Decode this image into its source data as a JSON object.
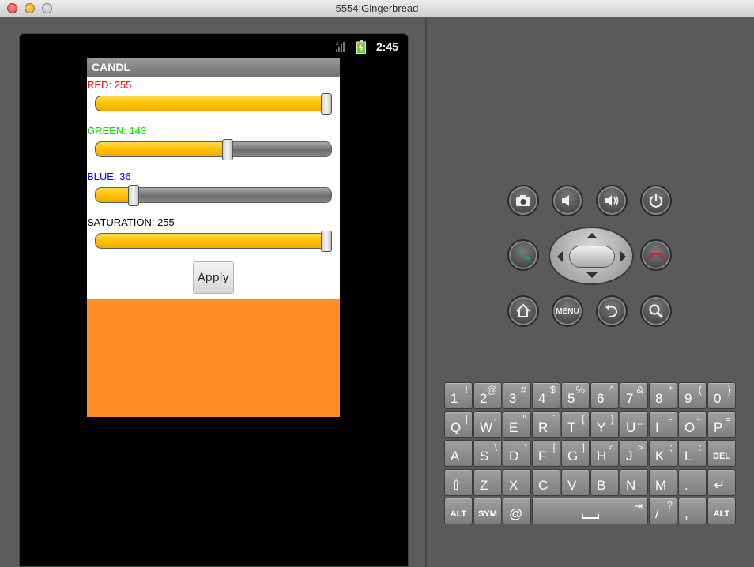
{
  "window": {
    "title": "5554:Gingerbread"
  },
  "status_bar": {
    "time": "2:45"
  },
  "app": {
    "title": "CANDL",
    "sliders": [
      {
        "label": "RED: 255",
        "value": 255,
        "max": 255,
        "color": "#ff0000"
      },
      {
        "label": "GREEN: 143",
        "value": 143,
        "max": 255,
        "color": "#00e000"
      },
      {
        "label": "BLUE: 36",
        "value": 36,
        "max": 255,
        "color": "#0000ff"
      },
      {
        "label": "SATURATION: 255",
        "value": 255,
        "max": 255,
        "color": "#000000"
      }
    ],
    "apply_label": "Apply",
    "preview_color": "#ff8f24"
  },
  "hardware_buttons": {
    "camera": "camera-icon",
    "volume_down": "volume-down-icon",
    "volume_up": "volume-up-icon",
    "power": "power-icon",
    "call": "call-icon",
    "end_call": "end-call-icon",
    "home": "home-icon",
    "menu_label": "MENU",
    "back": "back-icon",
    "search": "search-icon"
  },
  "keyboard": {
    "rows": [
      [
        {
          "m": "1",
          "a": "!"
        },
        {
          "m": "2",
          "a": "@"
        },
        {
          "m": "3",
          "a": "#"
        },
        {
          "m": "4",
          "a": "$"
        },
        {
          "m": "5",
          "a": "%"
        },
        {
          "m": "6",
          "a": "^"
        },
        {
          "m": "7",
          "a": "&"
        },
        {
          "m": "8",
          "a": "*"
        },
        {
          "m": "9",
          "a": "("
        },
        {
          "m": "0",
          "a": ")"
        }
      ],
      [
        {
          "m": "Q",
          "a": "|"
        },
        {
          "m": "W",
          "a": "~"
        },
        {
          "m": "E",
          "a": "\""
        },
        {
          "m": "R",
          "a": "`"
        },
        {
          "m": "T",
          "a": "{"
        },
        {
          "m": "Y",
          "a": "}"
        },
        {
          "m": "U",
          "a": "_"
        },
        {
          "m": "I",
          "a": "-"
        },
        {
          "m": "O",
          "a": "+"
        },
        {
          "m": "P",
          "a": "="
        }
      ],
      [
        {
          "m": "A",
          "a": ""
        },
        {
          "m": "S",
          "a": "\\"
        },
        {
          "m": "D",
          "a": "'"
        },
        {
          "m": "F",
          "a": "["
        },
        {
          "m": "G",
          "a": "]"
        },
        {
          "m": "H",
          "a": "<"
        },
        {
          "m": "J",
          "a": ">"
        },
        {
          "m": "K",
          "a": ";"
        },
        {
          "m": "L",
          "a": ":"
        },
        {
          "m": "DEL",
          "a": ""
        }
      ],
      [
        {
          "m": "⇧",
          "a": ""
        },
        {
          "m": "Z",
          "a": ""
        },
        {
          "m": "X",
          "a": ""
        },
        {
          "m": "C",
          "a": ""
        },
        {
          "m": "V",
          "a": ""
        },
        {
          "m": "B",
          "a": ""
        },
        {
          "m": "N",
          "a": ""
        },
        {
          "m": "M",
          "a": ""
        },
        {
          "m": ".",
          "a": ""
        },
        {
          "m": "↵",
          "a": ""
        }
      ],
      [
        {
          "m": "ALT",
          "a": ""
        },
        {
          "m": "SYM",
          "a": ""
        },
        {
          "m": "@",
          "a": ""
        },
        {
          "m": "space",
          "a": ""
        },
        {
          "m": "/",
          "a": "?"
        },
        {
          "m": ",",
          "a": ""
        },
        {
          "m": "ALT",
          "a": ""
        }
      ]
    ]
  }
}
